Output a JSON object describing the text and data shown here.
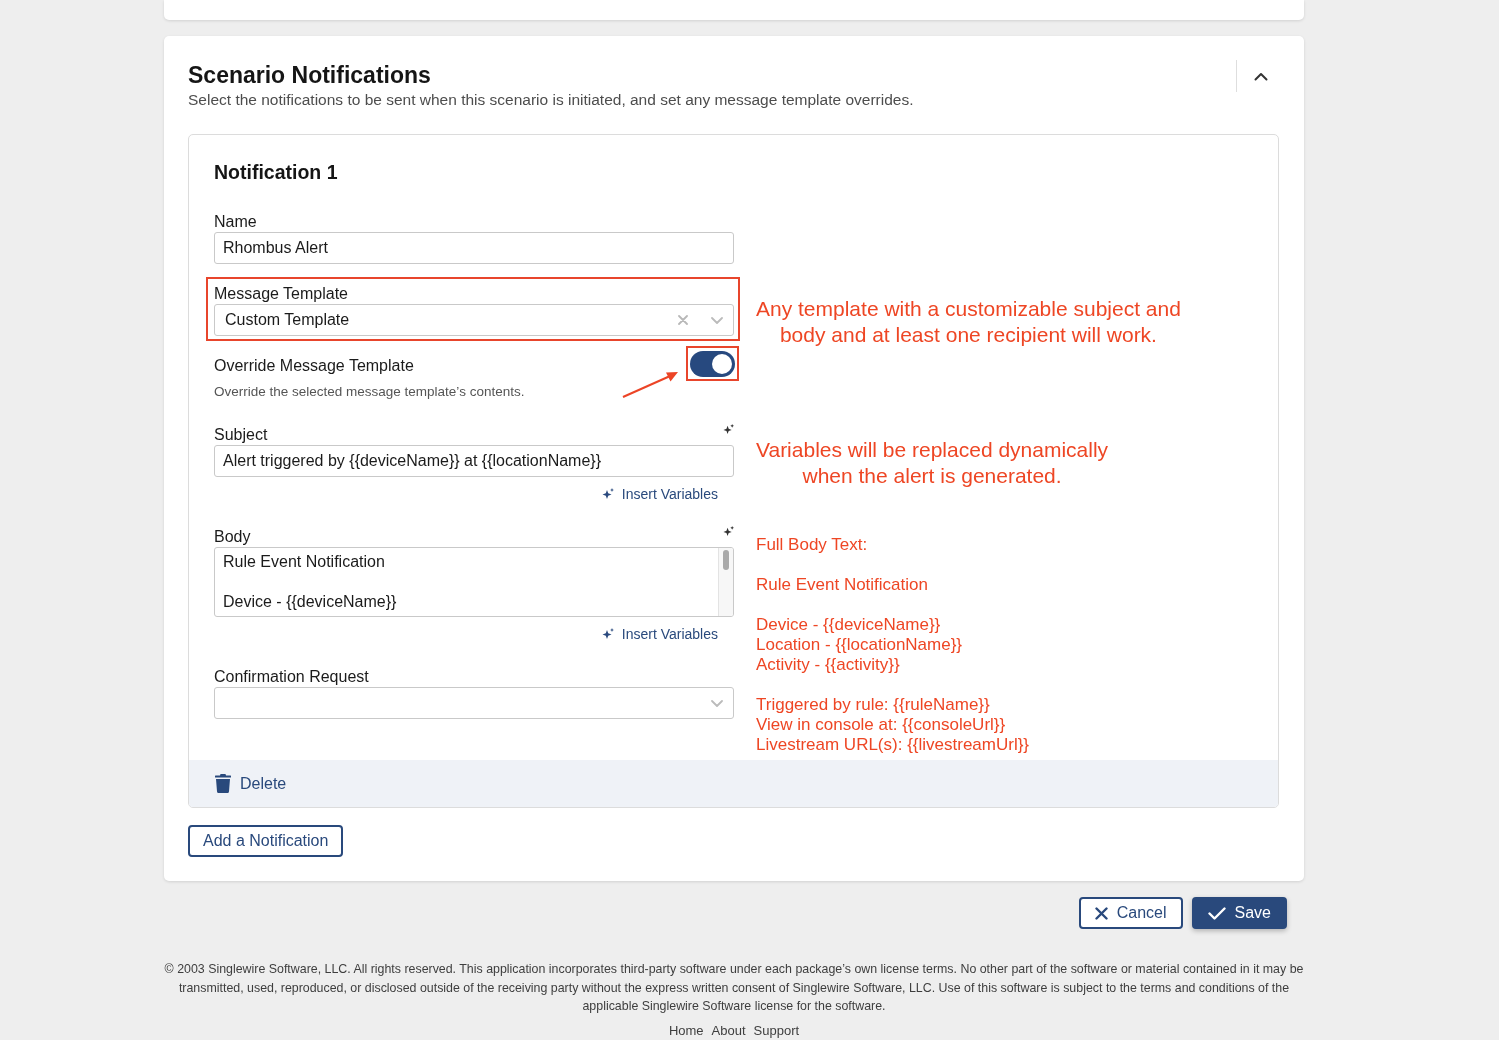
{
  "section": {
    "title": "Scenario Notifications",
    "subtitle": "Select the notifications to be sent when this scenario is initiated, and set any message template overrides.",
    "expanded": true,
    "notifications": [
      {
        "title": "Notification 1",
        "fields": [
          {
            "kind": "text",
            "label": "Name",
            "value": "Rhombus Alert"
          },
          {
            "kind": "select",
            "label": "Message Template",
            "value": "Custom Template",
            "highlighted": true,
            "note": {
              "kind": "callout",
              "text": "Any template with a customizable subject and\nbody and at least one recipient will work."
            }
          },
          {
            "kind": "toggle",
            "label": "Override Message Template",
            "description": "Override the selected message template’s contents.",
            "on": true,
            "highlighted": true,
            "pointer_arrow": true
          },
          {
            "kind": "text",
            "label": "Subject",
            "value": "Alert triggered by {{deviceName}} at {{locationName}}",
            "insert_label": "Insert Variables",
            "note": {
              "kind": "callout",
              "text": "Variables will be replaced dynamically\nwhen the alert is generated."
            }
          },
          {
            "kind": "textarea",
            "label": "Body",
            "value": "Rule Event Notification\n\nDevice - {{deviceName}}",
            "insert_label": "Insert Variables",
            "note": {
              "kind": "listing",
              "text": "Full Body Text:\n\nRule Event Notification\n\nDevice - {{deviceName}}\nLocation - {{locationName}}\nActivity - {{activity}}\n\nTriggered by rule: {{ruleName}}\nView in console at: {{consoleUrl}}\nLivestream URL(s): {{livestreamUrl}}"
            }
          },
          {
            "kind": "select",
            "label": "Confirmation Request"
          }
        ],
        "delete_label": "Delete"
      }
    ],
    "add_label": "Add a Notification"
  },
  "actions": [
    {
      "kind": "cancel",
      "label": "Cancel"
    },
    {
      "kind": "save",
      "label": "Save"
    }
  ],
  "footer": {
    "copyright": "© 2003 Singlewire Software, LLC. All rights reserved. This application incorporates third-party software under each package’s own license terms. No other part of the software or material contained in it may be transmitted, used, reproduced, or disclosed outside of the receiving party without the express written consent of Singlewire Software, LLC. Use of this software is subject to the terms and conditions of the applicable Singlewire Software license for the software.",
    "links": [
      "Home",
      "About",
      "Support"
    ]
  }
}
